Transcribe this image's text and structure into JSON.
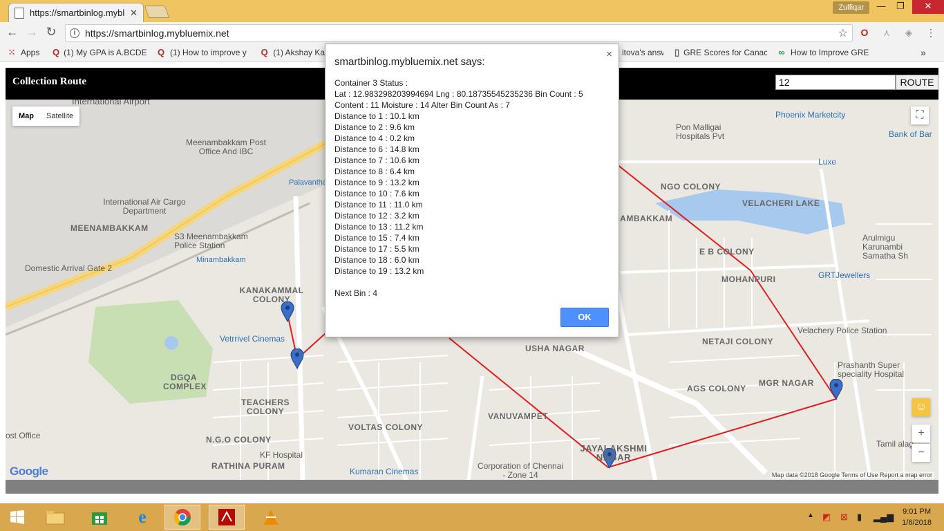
{
  "browser": {
    "tab_title": "https://smartbinlog.mybl",
    "user_name": "Zulfiqar",
    "url": "https://smartbinlog.mybluemix.net"
  },
  "bookmarks": [
    {
      "label": "Apps",
      "icon": "apps-icon"
    },
    {
      "label": "(1) My GPA is A.BCDE",
      "icon": "quora-icon"
    },
    {
      "label": "(1) How to improve y",
      "icon": "quora-icon"
    },
    {
      "label": "(1) Akshay Ka",
      "icon": "quora-icon"
    },
    {
      "label": "itova's answ",
      "icon": "quora-icon"
    },
    {
      "label": "GRE Scores for Canac",
      "icon": "page-icon"
    },
    {
      "label": "How to Improve GRE",
      "icon": "link-icon"
    }
  ],
  "app": {
    "title": "Collection Route",
    "route_value": "12",
    "route_button": "ROUTE"
  },
  "map": {
    "type_map": "Map",
    "type_satellite": "Satellite",
    "zoom_in": "+",
    "zoom_out": "−",
    "logo": "Google",
    "attribution": "Map data ©2018 Google    Terms of Use    Report a map error",
    "labels": {
      "airport": "International Airport",
      "meenambakkam_po": "Meenambakkam Post Office And IBC",
      "cargo": "International Air Cargo Department",
      "meenambakkam": "MEENAMBAKKAM",
      "s3": "S3 Meenambakkam Police Station",
      "arrival": "Domestic Arrival Gate 2",
      "kanakammal": "KANAKAMMAL COLONY",
      "vetrivel": "Vetrrivel Cinemas",
      "dgqa": "DGQA COMPLEX",
      "teachers": "TEACHERS COLONY",
      "ngo": "N.G.O COLONY",
      "kf": "KF Hospital",
      "rathina": "RATHINA PURAM",
      "voltas": "VOLTAS COLONY",
      "kumaran": "Kumaran Cinemas",
      "usha": "USHA NAGAR",
      "vanuvampet": "VANUVAMPET",
      "jayalakshmi": "JAYALAKSHMI NAGAR",
      "corporation": "Corporation of Chennai - Zone 14",
      "netaji": "NETAJI COLONY",
      "ags": "AGS COLONY",
      "mgr": "MGR NAGAR",
      "velachery_ps": "Velachery Police Station",
      "prashanth": "Prashanth Super speciality Hospital",
      "pon": "Pon Malligai Hospitals Pvt",
      "phoenix": "Phoenix Marketcity",
      "luxe": "Luxe",
      "ngo_colony": "NGO COLONY",
      "velacheri_lake": "VELACHERI LAKE",
      "mohanpuri": "MOHANPURI",
      "eb": "E B COLONY",
      "grt": "GRTJewellers",
      "arulmigu": "Arulmigu Karunambi Samatha Sh",
      "bank": "Bank of Bar",
      "pc": "Palavantha",
      "kf_postoffice": "ost Office",
      "minambakkam": "Minambakkam",
      "tambaram": "DAMBAKKAM",
      "tamil": "Tamil alag"
    }
  },
  "dialog": {
    "title": "smartbinlog.mybluemix.net says:",
    "close": "×",
    "lines": [
      "Container 3 Status :",
      "Lat : 12.983298203994694 Lng : 80.18735545235236 Bin Count :  5",
      "Content : 11 Moisture : 14 Alter Bin Count As :  7",
      "Distance to 1 : 10.1 km",
      "Distance to 2 : 9.6 km",
      "Distance to 4 : 0.2 km",
      "Distance to 6 : 14.8 km",
      "Distance to 7 : 10.6 km",
      "Distance to 8 : 6.4 km",
      "Distance to 9 : 13.2 km",
      "Distance to 10 : 7.6 km",
      "Distance to 11 : 11.0 km",
      "Distance to 12 : 3.2 km",
      "Distance to 13 : 11.2 km",
      "Distance to 15 : 7.4 km",
      "Distance to 17 : 5.5 km",
      "Distance to 18 : 6.0 km",
      "Distance to 19 : 13.2 km"
    ],
    "next_bin": "Next Bin : 4",
    "ok": "OK"
  },
  "taskbar": {
    "time": "9:01 PM",
    "date": "1/6/2018"
  },
  "colors": {
    "route": "#e21c1c",
    "marker": "#3a6fc8",
    "accent": "#4d90fe"
  }
}
